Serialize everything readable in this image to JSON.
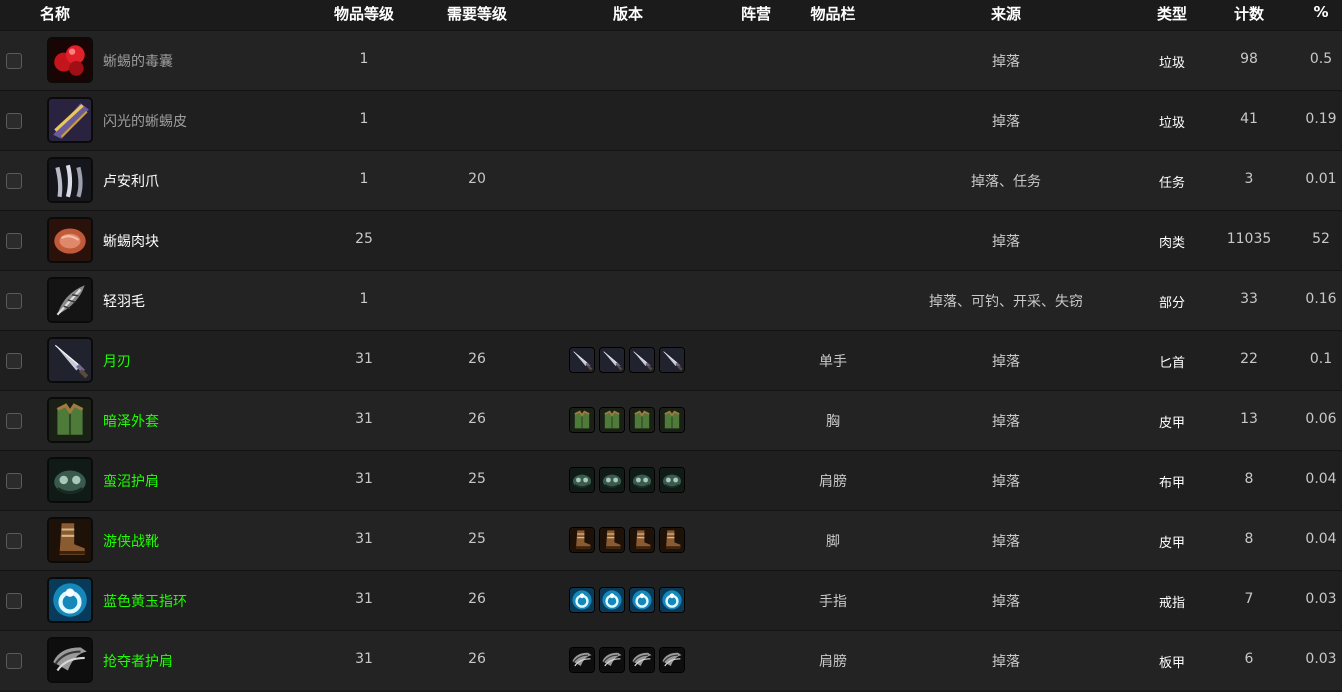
{
  "headers": {
    "name": "名称",
    "item_level": "物品等级",
    "req_level": "需要等级",
    "version": "版本",
    "faction": "阵营",
    "slot": "物品栏",
    "source": "来源",
    "type": "类型",
    "count": "计数",
    "percent": "%"
  },
  "colors": {
    "poor": "#9d9d9d",
    "common": "#ffffff",
    "uncommon": "#1eff00"
  },
  "rows": [
    {
      "name": "蜥蜴的毒囊",
      "quality": "poor",
      "icon": "red-venom-sac-icon",
      "item_level": "1",
      "req_level": "",
      "versions": [],
      "slot": "",
      "source": "掉落",
      "type": "垃圾",
      "count": "98",
      "percent": "0.5"
    },
    {
      "name": "闪光的蜥蜴皮",
      "quality": "poor",
      "icon": "shimmering-hide-icon",
      "item_level": "1",
      "req_level": "",
      "versions": [],
      "slot": "",
      "source": "掉落",
      "type": "垃圾",
      "count": "41",
      "percent": "0.19"
    },
    {
      "name": "卢安利爪",
      "quality": "common",
      "icon": "claw-icon",
      "item_level": "1",
      "req_level": "20",
      "versions": [],
      "slot": "",
      "source": "掉落、任务",
      "type": "任务",
      "count": "3",
      "percent": "0.01"
    },
    {
      "name": "蜥蜴肉块",
      "quality": "common",
      "icon": "meat-chunk-icon",
      "item_level": "25",
      "req_level": "",
      "versions": [],
      "slot": "",
      "source": "掉落",
      "type": "肉类",
      "count": "11035",
      "percent": "52"
    },
    {
      "name": "轻羽毛",
      "quality": "common",
      "icon": "feather-icon",
      "item_level": "1",
      "req_level": "",
      "versions": [],
      "slot": "",
      "source": "掉落、可钓、开采、失窃",
      "type": "部分",
      "count": "33",
      "percent": "0.16"
    },
    {
      "name": "月刃",
      "quality": "uncommon",
      "icon": "dagger-icon",
      "item_level": "31",
      "req_level": "26",
      "versions": [
        "dagger-icon",
        "dagger-icon",
        "dagger-icon",
        "dagger-icon"
      ],
      "slot": "单手",
      "source": "掉落",
      "type": "匕首",
      "count": "22",
      "percent": "0.1"
    },
    {
      "name": "暗泽外套",
      "quality": "uncommon",
      "icon": "leather-vest-icon",
      "item_level": "31",
      "req_level": "26",
      "versions": [
        "leather-vest-icon",
        "leather-vest-icon",
        "leather-vest-icon",
        "leather-vest-icon"
      ],
      "slot": "胸",
      "source": "掉落",
      "type": "皮甲",
      "count": "13",
      "percent": "0.06"
    },
    {
      "name": "蛮沼护肩",
      "quality": "uncommon",
      "icon": "cloth-shoulder-icon",
      "item_level": "31",
      "req_level": "25",
      "versions": [
        "cloth-shoulder-icon",
        "cloth-shoulder-icon",
        "cloth-shoulder-icon",
        "cloth-shoulder-icon"
      ],
      "slot": "肩膀",
      "source": "掉落",
      "type": "布甲",
      "count": "8",
      "percent": "0.04"
    },
    {
      "name": "游侠战靴",
      "quality": "uncommon",
      "icon": "boots-icon",
      "item_level": "31",
      "req_level": "25",
      "versions": [
        "boots-icon",
        "boots-icon",
        "boots-icon",
        "boots-icon"
      ],
      "slot": "脚",
      "source": "掉落",
      "type": "皮甲",
      "count": "8",
      "percent": "0.04"
    },
    {
      "name": "蓝色黄玉指环",
      "quality": "uncommon",
      "icon": "ring-icon",
      "item_level": "31",
      "req_level": "26",
      "versions": [
        "ring-icon",
        "ring-icon",
        "ring-icon",
        "ring-icon"
      ],
      "slot": "手指",
      "source": "掉落",
      "type": "戒指",
      "count": "7",
      "percent": "0.03"
    },
    {
      "name": "抢夺者护肩",
      "quality": "uncommon",
      "icon": "plate-shoulder-icon",
      "item_level": "31",
      "req_level": "26",
      "versions": [
        "plate-shoulder-icon",
        "plate-shoulder-icon",
        "plate-shoulder-icon",
        "plate-shoulder-icon"
      ],
      "slot": "肩膀",
      "source": "掉落",
      "type": "板甲",
      "count": "6",
      "percent": "0.03"
    }
  ]
}
